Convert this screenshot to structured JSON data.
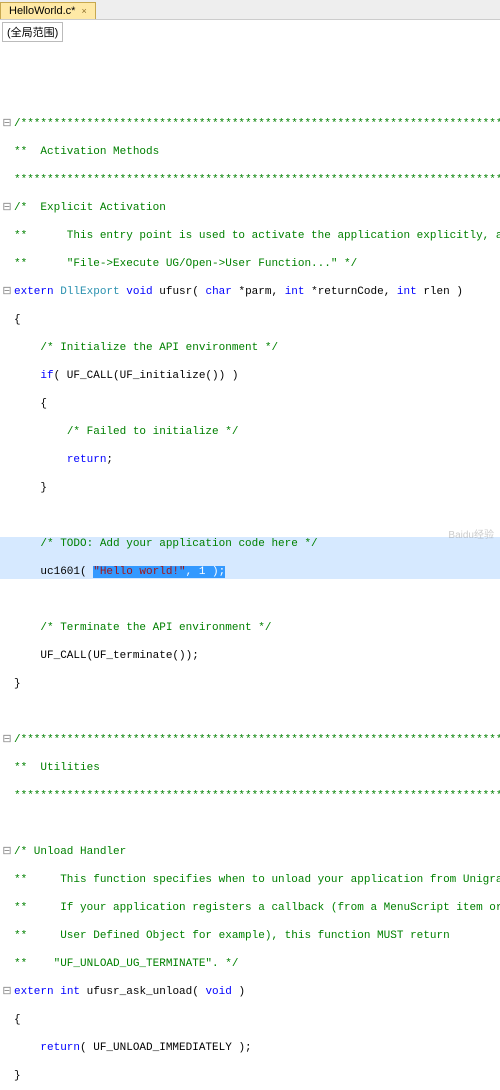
{
  "tab": {
    "title": "HelloWorld.c*",
    "close": "×"
  },
  "scope": "(全局范围)",
  "fold": {
    "collapse": "⊟",
    "none": " "
  },
  "code": {
    "bar1": "/******************************************************************************",
    "actMethods": "**  Activation Methods",
    "bar1end": "******************************************************************************/",
    "explicitAct": "/*  Explicit Activation",
    "entry1": "**      This entry point is used to activate the application explicitly, as in",
    "entry2": "**      \"File->Execute UG/Open->User Function...\" */",
    "kw_extern": "extern",
    "kw_void": "void",
    "kw_char": "char",
    "kw_int": "int",
    "kw_if": "if",
    "kw_return": "return",
    "ty_DllExport": "DllExport",
    "fn_ufusr": " ufusr( ",
    "p_parm": " *parm, ",
    "p_ret": " *returnCode, ",
    "p_rlen": " rlen )",
    "lbrace": "{",
    "rbrace": "}",
    "initComment": "/* Initialize the API environment */",
    "ifLine": "( UF_CALL(UF_initialize()) )",
    "failComment": "/* Failed to initialize */",
    "retSemi": ";",
    "todoComment": "/* TODO: Add your application code here */",
    "uc1601a": "uc1601( ",
    "helloStr": "\"Hello world!\"",
    "uc1601b": ", 1 );",
    "termComment": "/* Terminate the API environment */",
    "termCall": "UF_CALL(UF_terminate());",
    "bar2": "/******************************************************************************",
    "utilities": "**  Utilities",
    "bar2end": "******************************************************************************/",
    "unloadHdr": "/* Unload Handler",
    "unload1": "**     This function specifies when to unload your application from Unigraphics.",
    "unload2": "**     If your application registers a callback (from a MenuScript item or a",
    "unload3": "**     User Defined Object for example), this function MUST return",
    "unload4": "**    \"UF_UNLOAD_UG_TERMINATE\". */",
    "askUnload": " ufusr_ask_unload( ",
    "askUnloadEnd": " )",
    "retUnload": "( UF_UNLOAD_IMMEDIATELY );"
  },
  "watermark": "Baidu经验"
}
